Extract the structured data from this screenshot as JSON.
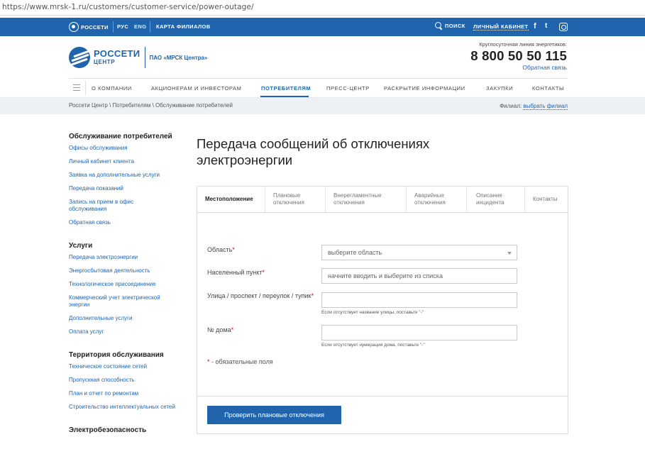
{
  "browser": {
    "url": "https://www.mrsk-1.ru/customers/customer-service/power-outage/"
  },
  "topbar": {
    "logo_text": "РОССЕТИ",
    "lang_ru": "РУС",
    "lang_en": "ENG",
    "branches_map": "КАРТА ФИЛИАЛОВ",
    "search": "ПОИСК",
    "cabinet": "ЛИЧНЫЙ КАБИНЕТ",
    "social": {
      "facebook": "f",
      "twitter": "t"
    }
  },
  "header": {
    "brand_name": "РОССЕТИ",
    "brand_sub": "ЦЕНТР",
    "org_name": "ПАО «МРСК Центра»",
    "hotline_caption": "Круглосуточная линия энергетиков:",
    "hotline_number": "8 800 50 50 115",
    "feedback_link": "Обратная связь"
  },
  "nav": {
    "items": [
      {
        "label": "О КОМПАНИИ"
      },
      {
        "label": "АКЦИОНЕРАМ И ИНВЕСТОРАМ"
      },
      {
        "label": "ПОТРЕБИТЕЛЯМ"
      },
      {
        "label": "ПРЕСС-ЦЕНТР"
      },
      {
        "label": "РАСКРЫТИЕ ИНФОРМАЦИИ"
      },
      {
        "label": "ЗАКУПКИ"
      },
      {
        "label": "КОНТАКТЫ"
      }
    ]
  },
  "breadcrumbs": {
    "text": "Россети Центр  \\  Потребителям  \\  Обслуживание потребителей",
    "branch_label": "Филиал:",
    "branch_value": "выбрать филиал"
  },
  "sidebar": {
    "sections": [
      {
        "title": "Обслуживание потребителей",
        "items": [
          "Офисы обслуживания",
          "Личный кабинет клиента",
          "Заявка на дополнительные услуги",
          "Передача показаний",
          "Запись на прием в офис обслуживания",
          "Обратная связь"
        ]
      },
      {
        "title": "Услуги",
        "items": [
          "Передача электроэнергии",
          "Энергосбытовая деятельность",
          "Технологическое присоединение",
          "Коммерческий учет электрической энергии",
          "Дополнительные услуги",
          "Оплата услуг"
        ]
      },
      {
        "title": "Территория обслуживания",
        "items": [
          "Техническое состояние сетей",
          "Пропускная способность",
          "План и отчет по ремонтам",
          "Строительство интеллектуальных сетей"
        ]
      },
      {
        "title": "Электробезопасность",
        "items": []
      }
    ]
  },
  "main": {
    "title": "Передача сообщений об отключениях электроэнергии",
    "tabs": [
      {
        "label": "Местоположение"
      },
      {
        "label": "Плановые отключения"
      },
      {
        "label": "Внерегламентные отключения"
      },
      {
        "label": "Аварийные отключения"
      },
      {
        "label": "Описание инцидента"
      },
      {
        "label": "Контакты"
      }
    ],
    "form": {
      "region_label": "Область",
      "region_value": "выберите область",
      "locality_label": "Населенный пункт",
      "locality_placeholder": "начните вводить и выберите из списка",
      "street_label": "Улица / проспект / переулок / тупик",
      "street_hint": "Если отсутствует название улицы, поставьте \"-\"",
      "house_label": "№ дома",
      "house_hint": "Если отсутствует нумерация дома, поставьте \"-\"",
      "required_mark": "*",
      "required_note": " - обязательные поля",
      "submit": "Проверить плановые отключения"
    }
  }
}
